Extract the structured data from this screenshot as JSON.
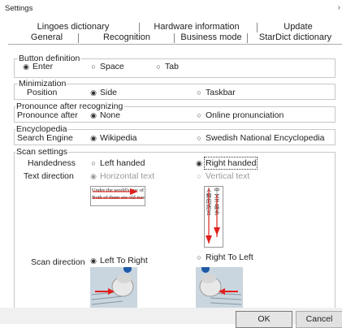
{
  "window": {
    "title": "Settings",
    "close_glyph": "›"
  },
  "tabs": {
    "top_row": [
      "Lingoes dictionary",
      "Hardware information",
      "Update"
    ],
    "bottom_row": [
      "General",
      "Recognition",
      "Business mode",
      "StarDict dictionary"
    ],
    "selected": "General"
  },
  "button_definition": {
    "legend": "Button definition",
    "options": [
      "Enter",
      "Space",
      "Tab"
    ],
    "selected": "Enter"
  },
  "minimization": {
    "legend": "Minimization",
    "label": "Position",
    "options": [
      "Side",
      "Taskbar"
    ],
    "selected": "Side"
  },
  "pronounce": {
    "legend": "Pronounce after recognizing",
    "label": "Pronounce after",
    "options": [
      "None",
      "Online pronunciation"
    ],
    "selected": "None"
  },
  "encyclopedia": {
    "legend": "Encyclopedia",
    "label": "Search Engine",
    "options": [
      "Wikipedia",
      "Swedish National Encyclopedia"
    ],
    "selected": "Wikipedia"
  },
  "scan_settings": {
    "legend": "Scan settings",
    "handedness_label": "Handedness",
    "handedness_options": [
      "Left handed",
      "Right handed"
    ],
    "handedness_selected": "Right handed",
    "text_direction_label": "Text direction",
    "text_direction_options": [
      "Horizontal text",
      "Vertical text"
    ],
    "text_direction_selected": "Horizontal text",
    "horizontal_sample": [
      "Under the world's eye of team o",
      "Both of them are old travels, one"
    ],
    "vertical_sample": [
      "人",
      "類",
      "的",
      "語",
      "言",
      "中",
      "文",
      "字",
      "最",
      "多"
    ],
    "scan_direction_label": "Scan direction",
    "scan_direction_options": [
      "Left To Right",
      "Right To Left"
    ],
    "scan_direction_selected": "Left To Right"
  },
  "footer": {
    "ok_label": "OK",
    "cancel_label": "Cancel"
  },
  "colors": {
    "arrow_red": "#e0201c",
    "tab_line": "#aaaaaa"
  }
}
